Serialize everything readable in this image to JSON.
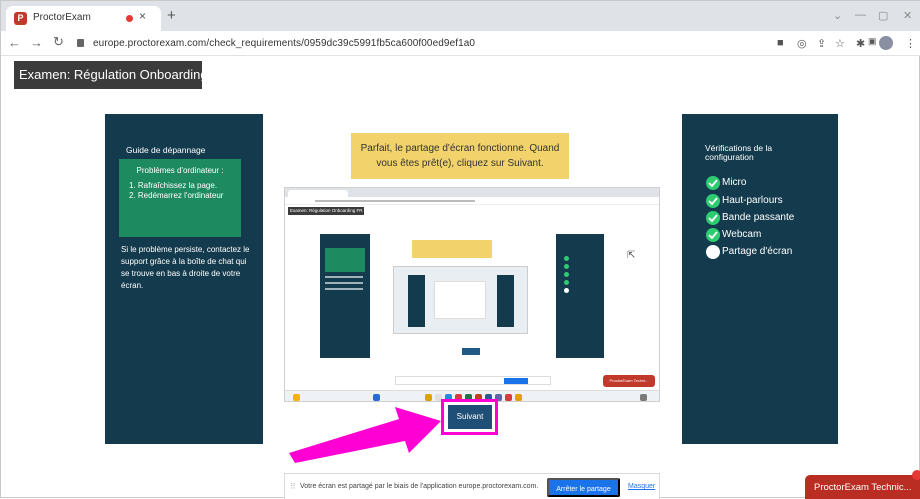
{
  "browser": {
    "tab_title": "ProctorExam",
    "tab_close": "×",
    "new_tab": "+",
    "favicon": "P",
    "url": "europe.proctorexam.com/check_requirements/0959dc39c5991fb5ca600f00ed9ef1a0",
    "window_controls": [
      "⌄",
      "—",
      "▢",
      "✕"
    ],
    "icons": [
      "back-icon",
      "forward-icon",
      "reload-icon",
      "lock-icon",
      "camera-icon",
      "eye-off-icon",
      "share-icon",
      "star-icon",
      "extensions-icon",
      "sidepanel-icon",
      "profile-icon"
    ]
  },
  "exam": {
    "title": "Examen: Régulation Onboarding FR"
  },
  "troubleshoot": {
    "heading": "Guide de dépannage",
    "box_title": "Problèmes d'ordinateur :",
    "steps": [
      "1. Rafraîchissez la page.",
      "2. Redémarrez l'ordinateur"
    ],
    "support_text": "Si le problème persiste, contactez le support grâce à la boîte de chat qui se trouve en bas à droite de votre écran."
  },
  "notice": {
    "message": "Parfait, le partage d'écran fonctionne. Quand vous êtes prêt(e), cliquez sur Suivant."
  },
  "preview": {
    "exam_title": "Examen: Régulation Onboarding FR",
    "chat_label": "ProctorExam Techni..."
  },
  "next_button": {
    "label": "Suivant"
  },
  "checks": {
    "heading": "Vérifications de la configuration",
    "items": [
      {
        "label": "Micro",
        "status": "ok"
      },
      {
        "label": "Haut-parlours",
        "status": "ok"
      },
      {
        "label": "Bande passante",
        "status": "ok"
      },
      {
        "label": "Webcam",
        "status": "ok"
      },
      {
        "label": "Partage d'écran",
        "status": "pending"
      }
    ]
  },
  "share_bar": {
    "message": "Votre écran est partagé par le biais de l'application europe.proctorexam.com.",
    "stop_label": "Arrêter le partage",
    "hide_label": "Masquer"
  },
  "chat": {
    "label": "ProctorExam Technic..."
  },
  "colors": {
    "panel": "#143b4d",
    "green": "#1e8a60",
    "yellow": "#f2d36b",
    "button": "#1f4f77",
    "highlight": "#ff00d4",
    "chat": "#b92d22",
    "check": "#2ecc71"
  }
}
